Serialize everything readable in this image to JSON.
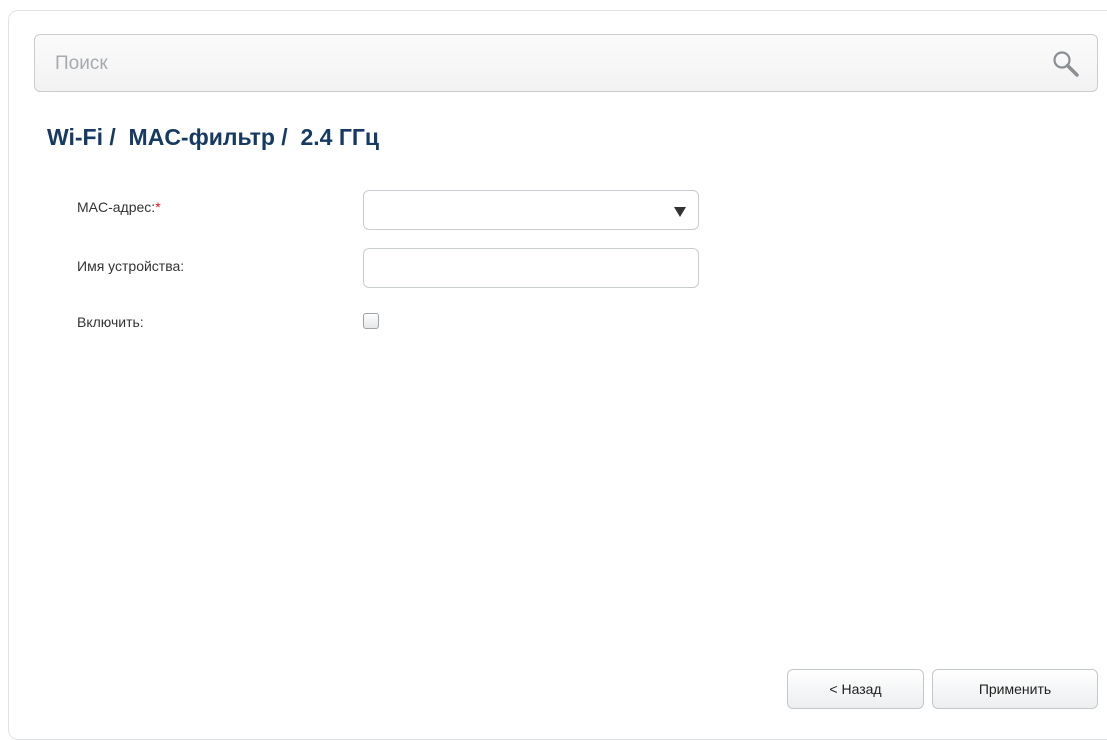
{
  "search": {
    "placeholder": "Поиск",
    "icon": "search-icon"
  },
  "breadcrumb": {
    "text": "Wi-Fi /  MAC-фильтр /  2.4 ГГц"
  },
  "form": {
    "mac_label": "MAC-адрес:",
    "required_mark": "*",
    "mac_value": "",
    "device_name_label": "Имя устройства:",
    "device_name_value": "",
    "enable_label": "Включить:",
    "enable_checked": false
  },
  "buttons": {
    "back": "< Назад",
    "apply": "Применить"
  },
  "colors": {
    "title": "#163a63",
    "required": "#e0141e"
  }
}
